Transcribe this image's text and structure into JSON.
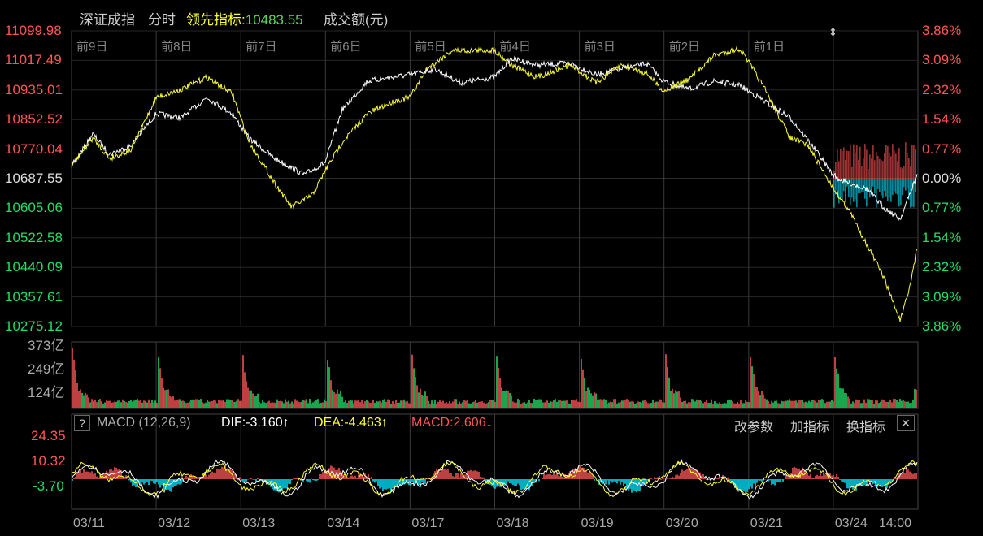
{
  "header": {
    "title": "深证成指",
    "mode": "分时",
    "leading_label": "领先指标",
    "leading_value": "10483.55",
    "volume_label": "成交额(元)"
  },
  "price_axis": [
    "11099.98",
    "11017.49",
    "10935.01",
    "10852.52",
    "10770.04",
    "10687.55",
    "10605.06",
    "10522.58",
    "10440.09",
    "10357.61",
    "10275.12"
  ],
  "pct_axis": [
    "3.86%",
    "3.09%",
    "2.32%",
    "1.54%",
    "0.77%",
    "0.00%",
    "0.77%",
    "1.54%",
    "2.32%",
    "3.09%",
    "3.86%"
  ],
  "day_labels": [
    "前9日",
    "前8日",
    "前7日",
    "前6日",
    "前5日",
    "前4日",
    "前3日",
    "前2日",
    "前1日"
  ],
  "volume_axis": [
    "373亿",
    "249亿",
    "124亿"
  ],
  "macd": {
    "help": "?",
    "name": "MACD (12,26,9)",
    "dif": "DIF:-3.160↑",
    "dea": "DEA:-4.463↑",
    "macd": "MACD:2.606↓",
    "axis": [
      "24.35",
      "10.32",
      "-3.70"
    ],
    "buttons": [
      "改参数",
      "加指标",
      "换指标"
    ],
    "close": "✕"
  },
  "dates": [
    "03/11",
    "03/12",
    "03/13",
    "03/14",
    "03/17",
    "03/18",
    "03/19",
    "03/20",
    "03/21",
    "03/24",
    "14:00"
  ],
  "colors": {
    "up": "#ff5555",
    "down": "#22dd66",
    "cyan": "#00e5ff",
    "yellow": "#ffff33",
    "white": "#ffffff",
    "grid": "#333333"
  }
}
